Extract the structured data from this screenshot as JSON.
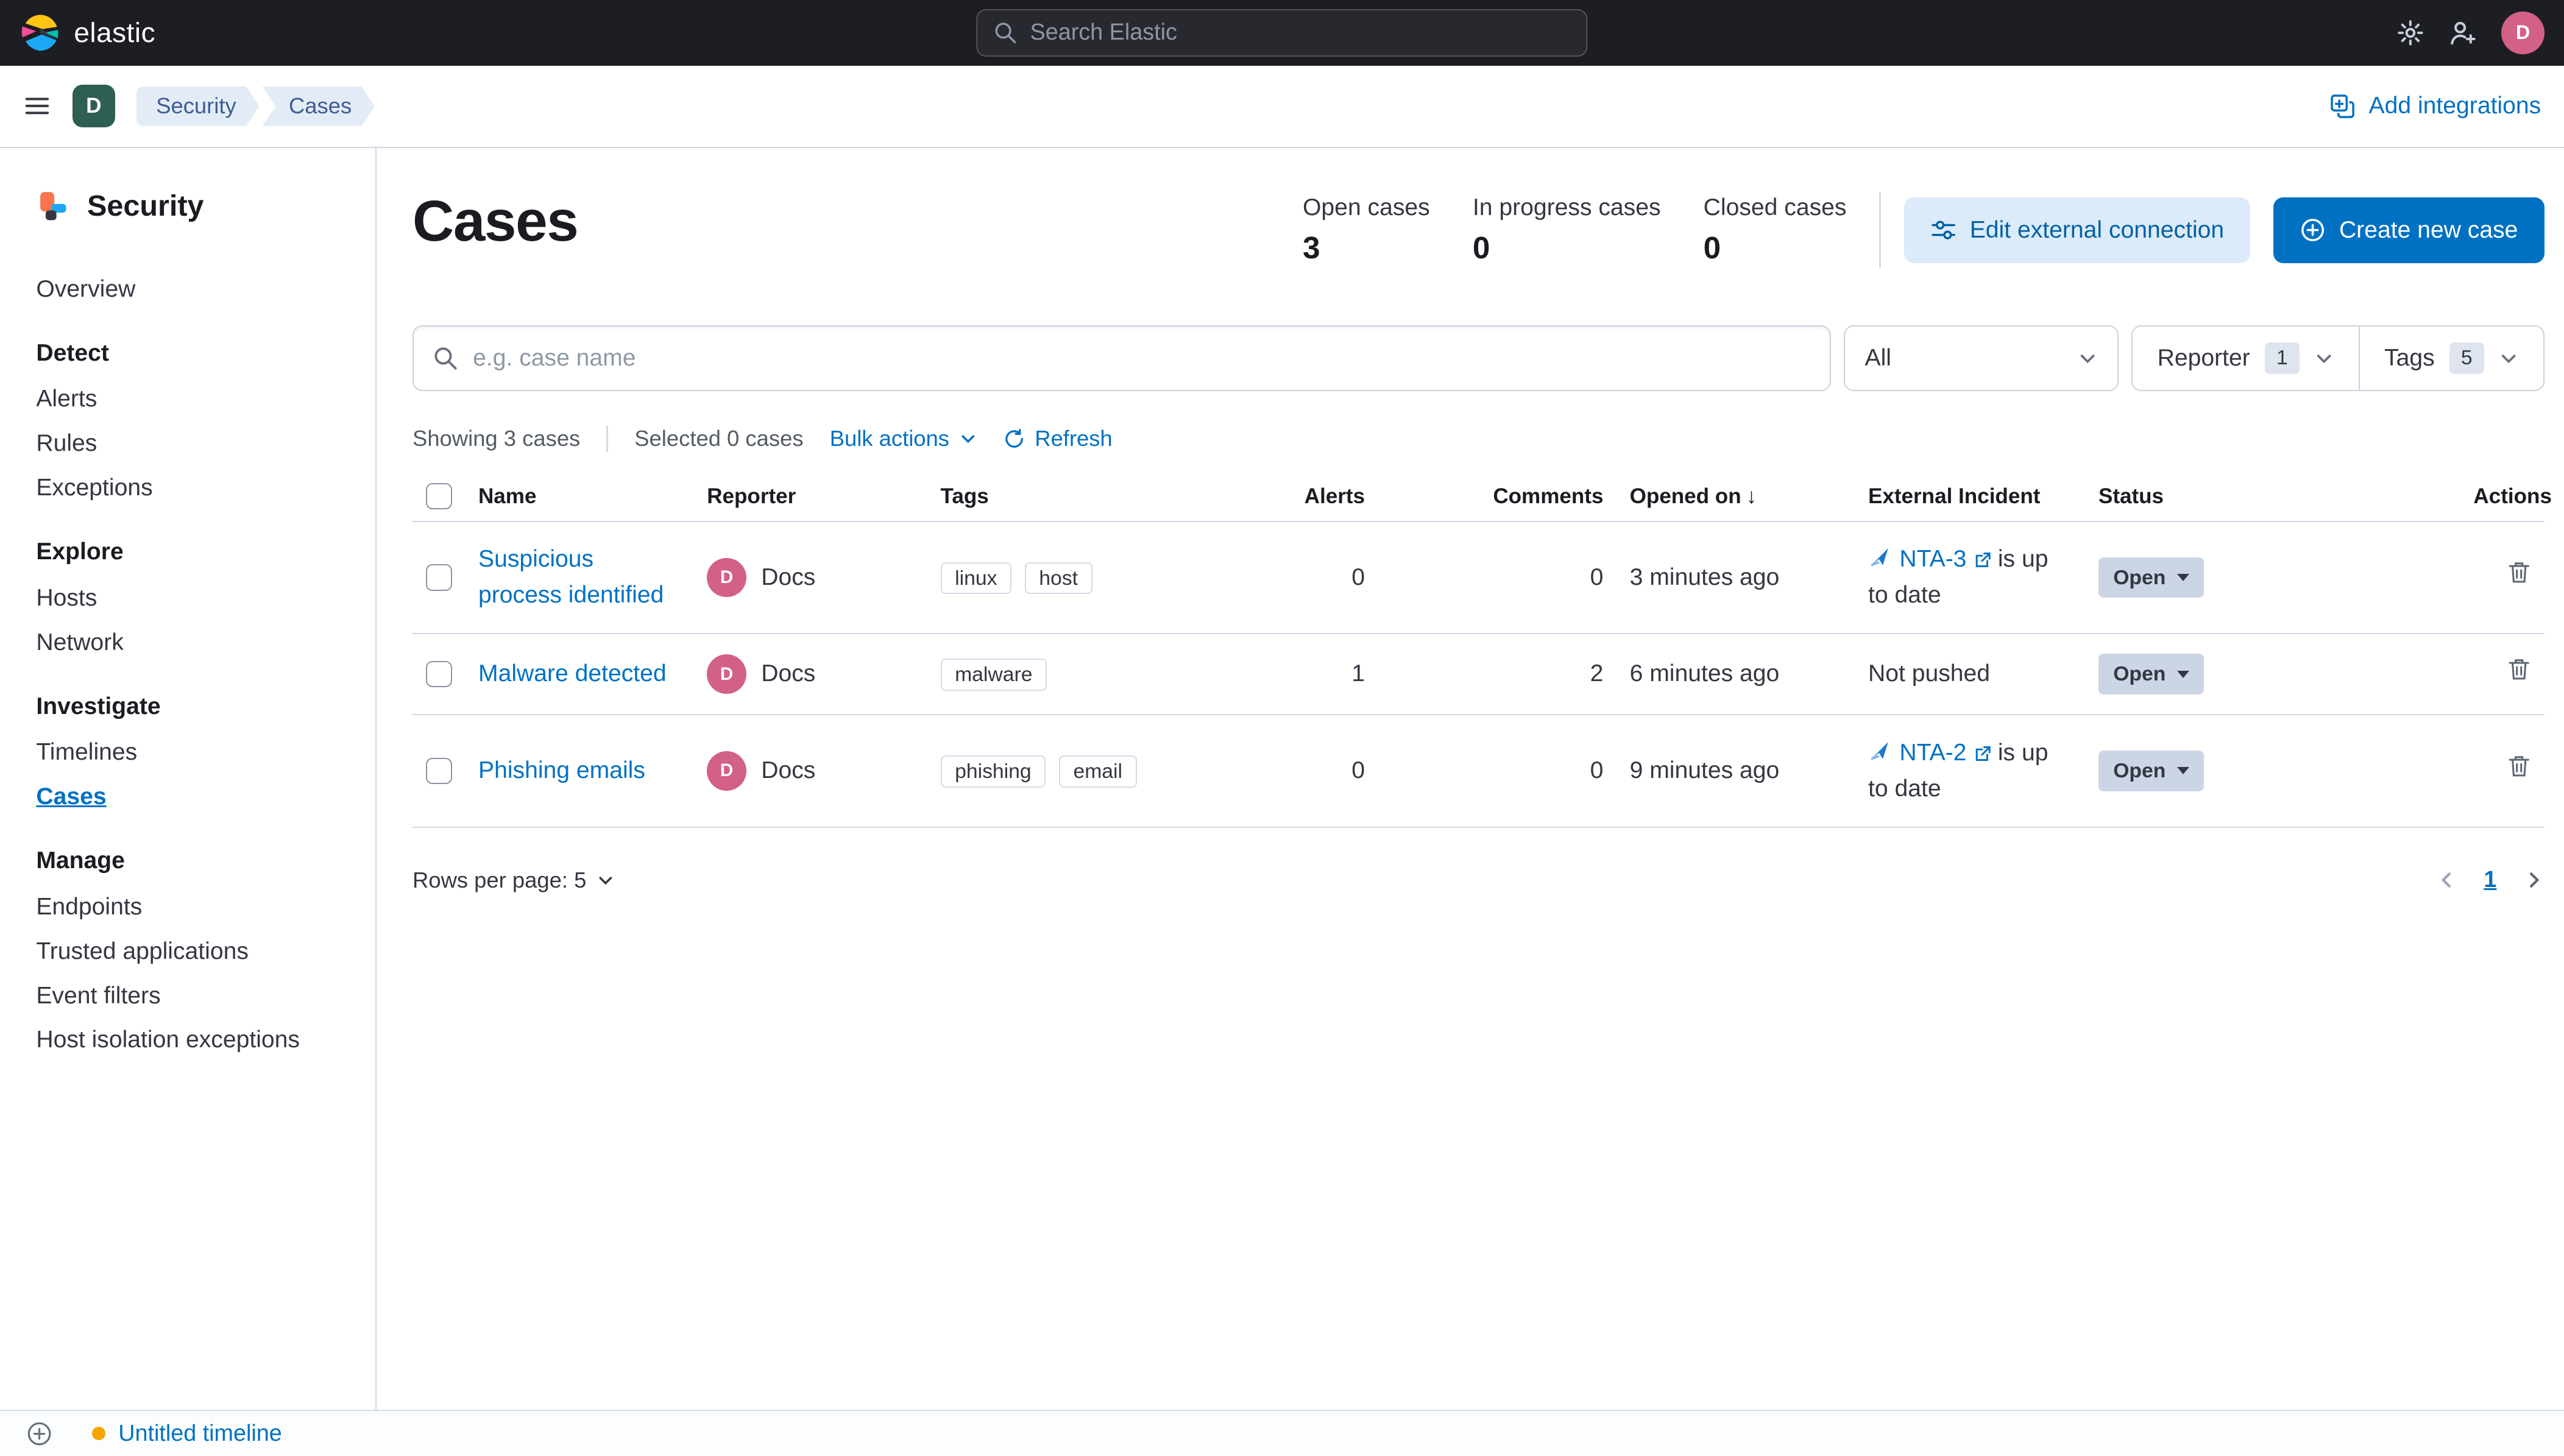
{
  "colors": {
    "primary_blue": "#0071C2",
    "topbar_bg": "#1D1E24",
    "avatar_pink": "#D36086",
    "space_badge": "#2F5E52",
    "status_badge_bg": "#CBD5E5",
    "timeline_dot": "#F5A700"
  },
  "topbar": {
    "brand": "elastic",
    "search_placeholder": "Search Elastic",
    "avatar_initial": "D"
  },
  "navbar": {
    "space_initial": "D",
    "breadcrumbs": [
      "Security",
      "Cases"
    ],
    "add_integrations_label": "Add integrations"
  },
  "sidebar": {
    "app_title": "Security",
    "overview": "Overview",
    "sections": [
      {
        "header": "Detect",
        "items": [
          "Alerts",
          "Rules",
          "Exceptions"
        ]
      },
      {
        "header": "Explore",
        "items": [
          "Hosts",
          "Network"
        ]
      },
      {
        "header": "Investigate",
        "items": [
          "Timelines",
          "Cases"
        ]
      },
      {
        "header": "Manage",
        "items": [
          "Endpoints",
          "Trusted applications",
          "Event filters",
          "Host isolation exceptions"
        ]
      }
    ],
    "active_item": "Cases"
  },
  "page": {
    "title": "Cases",
    "stats": [
      {
        "label": "Open cases",
        "value": "3"
      },
      {
        "label": "In progress cases",
        "value": "0"
      },
      {
        "label": "Closed cases",
        "value": "0"
      }
    ],
    "edit_external_connection_label": "Edit external connection",
    "create_new_case_label": "Create new case"
  },
  "filters": {
    "search_placeholder": "e.g. case name",
    "status_filter_value": "All",
    "reporter_label": "Reporter",
    "reporter_count": "1",
    "tags_label": "Tags",
    "tags_count": "5"
  },
  "utility": {
    "showing": "Showing 3 cases",
    "selected": "Selected 0 cases",
    "bulk_actions_label": "Bulk actions",
    "refresh_label": "Refresh"
  },
  "table": {
    "headers": [
      "Name",
      "Reporter",
      "Tags",
      "Alerts",
      "Comments",
      "Opened on",
      "External Incident",
      "Status",
      "Actions"
    ],
    "rows": [
      {
        "name": "Suspicious process identified",
        "reporter": "Docs",
        "reporter_initial": "D",
        "tags": [
          "linux",
          "host"
        ],
        "alerts": "0",
        "comments": "0",
        "opened_on": "3 minutes ago",
        "external_incident": {
          "link": "NTA-3",
          "suffix": "is up to date"
        },
        "status": "Open"
      },
      {
        "name": "Malware detected",
        "reporter": "Docs",
        "reporter_initial": "D",
        "tags": [
          "malware"
        ],
        "alerts": "1",
        "comments": "2",
        "opened_on": "6 minutes ago",
        "external_incident": {
          "text": "Not pushed"
        },
        "status": "Open"
      },
      {
        "name": "Phishing emails",
        "reporter": "Docs",
        "reporter_initial": "D",
        "tags": [
          "phishing",
          "email"
        ],
        "alerts": "0",
        "comments": "0",
        "opened_on": "9 minutes ago",
        "external_incident": {
          "link": "NTA-2",
          "suffix": "is up to date"
        },
        "status": "Open"
      }
    ]
  },
  "table_footer": {
    "rows_per_page_label": "Rows per page: 5",
    "page": "1"
  },
  "timeline_bar": {
    "label": "Untitled timeline"
  }
}
